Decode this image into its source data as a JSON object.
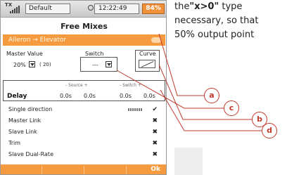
{
  "status": {
    "tx": "TX",
    "model": "Default",
    "time": "12:22:49",
    "battery": "84%"
  },
  "screen_title": "Free Mixes",
  "mix_bar": {
    "label": "Aileron → Elevator"
  },
  "master_value": {
    "label": "Master Value",
    "value": "20%",
    "paren": "( 20)"
  },
  "switch": {
    "label": "Switch",
    "value": "---"
  },
  "curve": {
    "label": "Curve"
  },
  "delay": {
    "label": "Delay",
    "source_header": "- Source +",
    "switch_header": "- Switch +",
    "values": [
      "0.0s",
      "0.0s",
      "0.0s",
      "0.0s"
    ]
  },
  "rows": [
    {
      "label": "Single direction",
      "mark": "✔"
    },
    {
      "label": "Master Link",
      "mark": "✖"
    },
    {
      "label": "Slave Link",
      "mark": "✖"
    },
    {
      "label": "Trim",
      "mark": "✖"
    },
    {
      "label": "Slave Dual-Rate",
      "mark": "✖"
    }
  ],
  "bottom": {
    "ok": "Ok"
  },
  "doc_text": {
    "line1a": "the",
    "line1b": "\"x>0\"",
    "line1c": " type",
    "line2": "necessary, so that",
    "line3": "50% output point"
  },
  "callouts": [
    "a",
    "b",
    "c",
    "d"
  ],
  "colors": {
    "accent": "#f59a3e",
    "callout": "#c0392b"
  }
}
